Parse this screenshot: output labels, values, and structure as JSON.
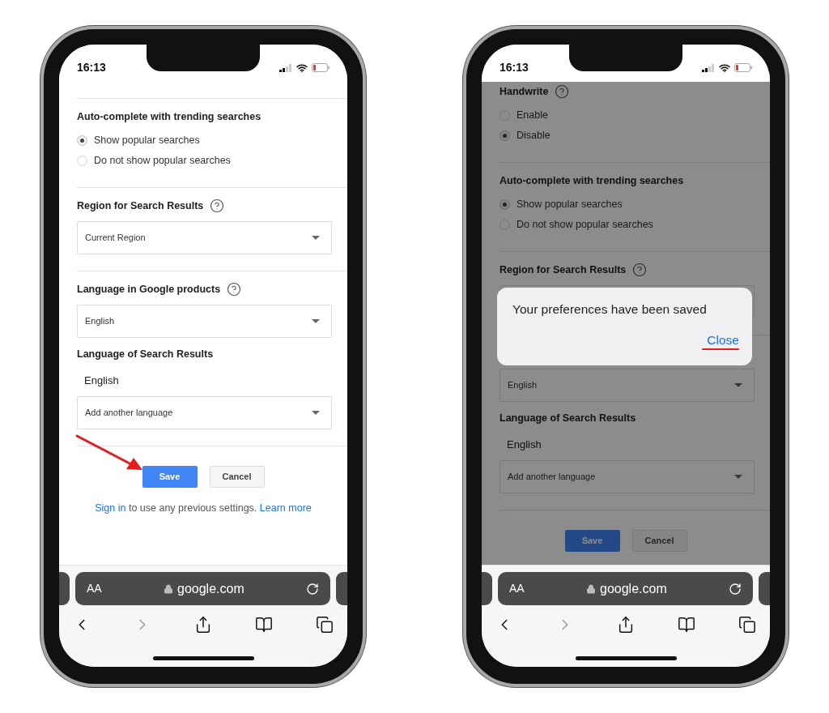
{
  "phones": [
    {
      "time": "16:13",
      "dimmed": false,
      "pointer_arrow": true,
      "items": [
        {
          "kind": "divider"
        },
        {
          "kind": "heading",
          "text": "Auto-complete with trending searches",
          "help": false
        },
        {
          "kind": "radio",
          "label": "Show popular searches",
          "selected": true
        },
        {
          "kind": "radio",
          "label": "Do not show popular searches",
          "selected": false
        },
        {
          "kind": "divider"
        },
        {
          "kind": "heading",
          "text": "Region for Search Results",
          "help": true
        },
        {
          "kind": "select",
          "value": "Current Region"
        },
        {
          "kind": "divider"
        },
        {
          "kind": "heading",
          "text": "Language in Google products",
          "help": true
        },
        {
          "kind": "select",
          "value": "English"
        },
        {
          "kind": "heading",
          "text": "Language of Search Results",
          "help": false
        },
        {
          "kind": "value",
          "text": "English"
        },
        {
          "kind": "select",
          "value": "Add another language"
        },
        {
          "kind": "divider"
        }
      ],
      "buttons": [
        {
          "label": "Save",
          "primary": true
        },
        {
          "label": "Cancel",
          "primary": false
        }
      ],
      "footer": {
        "link": "Sign in",
        "text": "to use any previous settings.",
        "link_2": "Learn more"
      },
      "browser": {
        "text_size": "AA",
        "url": "google.com",
        "forward_disabled": true
      }
    },
    {
      "time": "16:13",
      "dimmed": true,
      "pointer_arrow": false,
      "items": [
        {
          "kind": "heading",
          "text": "Handwrite",
          "help": true
        },
        {
          "kind": "radio",
          "label": "Enable",
          "selected": false
        },
        {
          "kind": "radio",
          "label": "Disable",
          "selected": true
        },
        {
          "kind": "divider"
        },
        {
          "kind": "heading",
          "text": "Auto-complete with trending searches",
          "help": false
        },
        {
          "kind": "radio",
          "label": "Show popular searches",
          "selected": true
        },
        {
          "kind": "radio",
          "label": "Do not show popular searches",
          "selected": false
        },
        {
          "kind": "divider"
        },
        {
          "kind": "heading",
          "text": "Region for Search Results",
          "help": true
        },
        {
          "kind": "select"
        },
        {
          "kind": "divider"
        },
        {
          "kind": "heading"
        },
        {
          "kind": "select",
          "value": "English"
        },
        {
          "kind": "heading",
          "text": "Language of Search Results",
          "help": false
        },
        {
          "kind": "value",
          "text": "English"
        },
        {
          "kind": "select",
          "value": "Add another language"
        },
        {
          "kind": "divider"
        }
      ],
      "buttons": [
        {
          "label": "Save",
          "primary": true
        },
        {
          "label": "Cancel",
          "primary": false
        }
      ],
      "dialog": {
        "message": "Your preferences have been saved",
        "action": "Close",
        "underlined": true
      },
      "browser": {
        "text_size": "AA",
        "url": "google.com",
        "forward_disabled": true
      }
    }
  ]
}
